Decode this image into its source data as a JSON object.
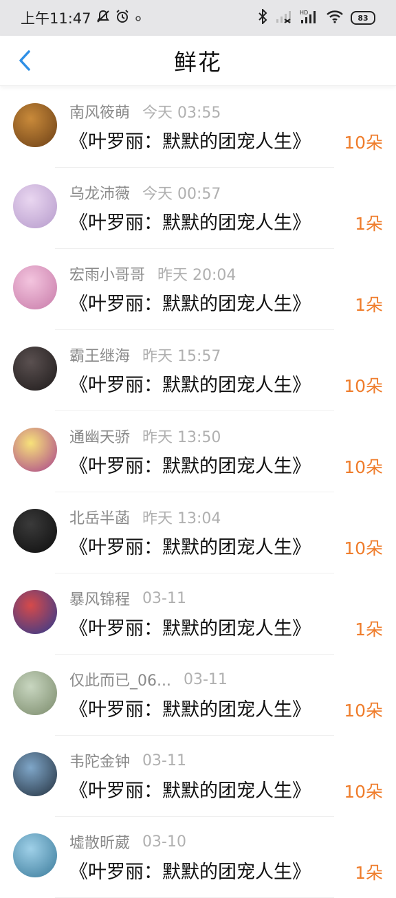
{
  "status_bar": {
    "time": "上午11:47",
    "battery": "83"
  },
  "header": {
    "title": "鲜花"
  },
  "colors": {
    "accent": "#ef7d2c",
    "back": "#2e8fe6"
  },
  "items": [
    {
      "name": "南风筱萌",
      "time": "今天 03:55",
      "book": "《叶罗丽：默默的团宠人生》",
      "count": "10朵",
      "avatar_colors": [
        "#c98a3a",
        "#6b3f16"
      ]
    },
    {
      "name": "乌龙沛薇",
      "time": "今天 00:57",
      "book": "《叶罗丽：默默的团宠人生》",
      "count": "1朵",
      "avatar_colors": [
        "#e9d6f0",
        "#b59acb"
      ]
    },
    {
      "name": "宏雨小哥哥",
      "time": "昨天 20:04",
      "book": "《叶罗丽：默默的团宠人生》",
      "count": "1朵",
      "avatar_colors": [
        "#f3c4de",
        "#c77aa8"
      ]
    },
    {
      "name": "霸王继海",
      "time": "昨天 15:57",
      "book": "《叶罗丽：默默的团宠人生》",
      "count": "10朵",
      "avatar_colors": [
        "#5a5050",
        "#1e1a1a"
      ]
    },
    {
      "name": "通幽天骄",
      "time": "昨天 13:50",
      "book": "《叶罗丽：默默的团宠人生》",
      "count": "10朵",
      "avatar_colors": [
        "#f7e27a",
        "#a8418c"
      ]
    },
    {
      "name": "北岳半菡",
      "time": "昨天 13:04",
      "book": "《叶罗丽：默默的团宠人生》",
      "count": "10朵",
      "avatar_colors": [
        "#3a3a3a",
        "#0d0d0d"
      ]
    },
    {
      "name": "暴风锦程",
      "time": "03-11",
      "book": "《叶罗丽：默默的团宠人生》",
      "count": "1朵",
      "avatar_colors": [
        "#d64a4a",
        "#2b3a8f"
      ]
    },
    {
      "name": "仅此而已_06...",
      "time": "03-11",
      "book": "《叶罗丽：默默的团宠人生》",
      "count": "10朵",
      "avatar_colors": [
        "#c8d6c0",
        "#7a8a6a"
      ]
    },
    {
      "name": "韦陀金钟",
      "time": "03-11",
      "book": "《叶罗丽：默默的团宠人生》",
      "count": "10朵",
      "avatar_colors": [
        "#7fa6c8",
        "#23303e"
      ]
    },
    {
      "name": "墟散昕葳",
      "time": "03-10",
      "book": "《叶罗丽：默默的团宠人生》",
      "count": "1朵",
      "avatar_colors": [
        "#9fd0e8",
        "#3a7a9a"
      ]
    }
  ]
}
